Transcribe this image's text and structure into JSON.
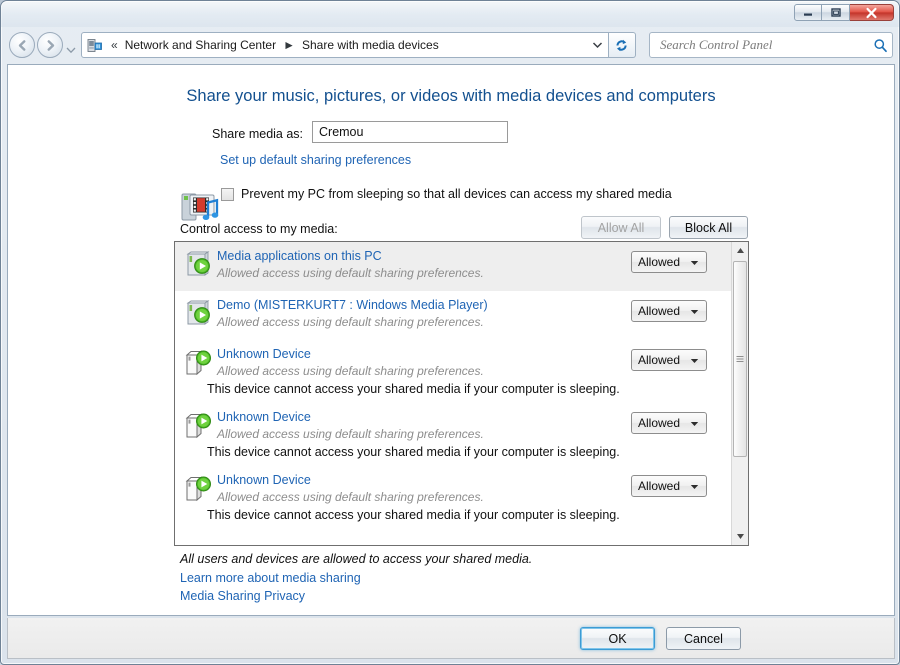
{
  "window": {
    "controls": {
      "minimize": "minimize",
      "maximize": "maximize",
      "close": "close"
    }
  },
  "nav": {
    "back": "Back",
    "forward": "Forward",
    "history": "Recent pages",
    "breadcrumb": {
      "overflow": "«",
      "items": [
        "Network and Sharing Center",
        "Share with media devices"
      ],
      "separator": "►"
    },
    "refresh": "Refresh",
    "search": {
      "placeholder": "Search Control Panel",
      "value": ""
    }
  },
  "page": {
    "title": "Share your music, pictures, or videos with media devices and computers",
    "share_media_as_label": "Share media as:",
    "share_media_as_value": "Cremou",
    "default_prefs_link": "Set up default sharing preferences",
    "prevent_sleep_label": "Prevent my PC from sleeping so that all devices can access my shared media",
    "prevent_sleep_checked": false,
    "control_access_label": "Control access to my media:",
    "allow_all_label": "Allow All",
    "allow_all_disabled": true,
    "block_all_label": "Block All",
    "all_allowed_note": "All users and devices are allowed to access your shared media.",
    "learn_more_link": "Learn more about media sharing",
    "privacy_link": "Media Sharing Privacy"
  },
  "devices": [
    {
      "name": "Media applications on this PC",
      "status": "Allowed access using default sharing preferences.",
      "warning": "",
      "permission": "Allowed",
      "icon": "media-pc-icon",
      "selected": true
    },
    {
      "name": "Demo (MISTERKURT7 : Windows Media Player)",
      "status": "Allowed access using default sharing preferences.",
      "warning": "",
      "permission": "Allowed",
      "icon": "media-pc-icon",
      "selected": false
    },
    {
      "name": "Unknown Device",
      "status": "Allowed access using default sharing preferences.",
      "warning": "This device cannot access your shared media if your computer is sleeping.",
      "permission": "Allowed",
      "icon": "unknown-device-icon",
      "selected": false
    },
    {
      "name": "Unknown Device",
      "status": "Allowed access using default sharing preferences.",
      "warning": "This device cannot access your shared media if your computer is sleeping.",
      "permission": "Allowed",
      "icon": "unknown-device-icon",
      "selected": false
    },
    {
      "name": "Unknown Device",
      "status": "Allowed access using default sharing preferences.",
      "warning": "This device cannot access your shared media if your computer is sleeping.",
      "permission": "Allowed",
      "icon": "unknown-device-icon",
      "selected": false
    }
  ],
  "footer": {
    "ok_label": "OK",
    "cancel_label": "Cancel"
  },
  "colors": {
    "link": "#1f64b4",
    "title": "#13508f",
    "close_button": "#c4352b",
    "focus_ring": "#3c9bd4",
    "selected_row": "#eeeeee"
  }
}
